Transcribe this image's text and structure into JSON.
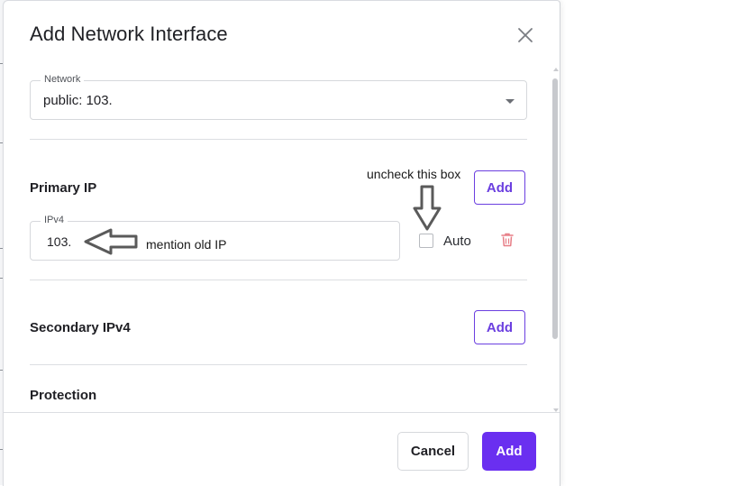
{
  "dialog": {
    "title": "Add Network Interface",
    "close_icon": "close-icon"
  },
  "network": {
    "label": "Network",
    "value": "public: 103.",
    "icon": "chevron-down-icon"
  },
  "primary_ip": {
    "heading": "Primary IP",
    "add_label": "Add",
    "ipv4_label": "IPv4",
    "ipv4_value": "103.",
    "auto_label": "Auto",
    "auto_checked": false,
    "delete_icon": "trash-icon"
  },
  "secondary_ipv4": {
    "heading": "Secondary IPv4",
    "add_label": "Add"
  },
  "protection": {
    "heading": "Protection"
  },
  "footer": {
    "cancel_label": "Cancel",
    "add_label": "Add"
  },
  "annotations": {
    "uncheck_note": "uncheck this box",
    "ip_note": "mention old IP",
    "down_arrow_icon": "arrow-down-icon",
    "left_arrow_icon": "arrow-left-icon"
  },
  "colors": {
    "accent": "#6a2ff0",
    "accent_outline": "#6b3fe0",
    "danger_icon": "#e77d86",
    "annotation_arrow": "#5a5a5a"
  }
}
